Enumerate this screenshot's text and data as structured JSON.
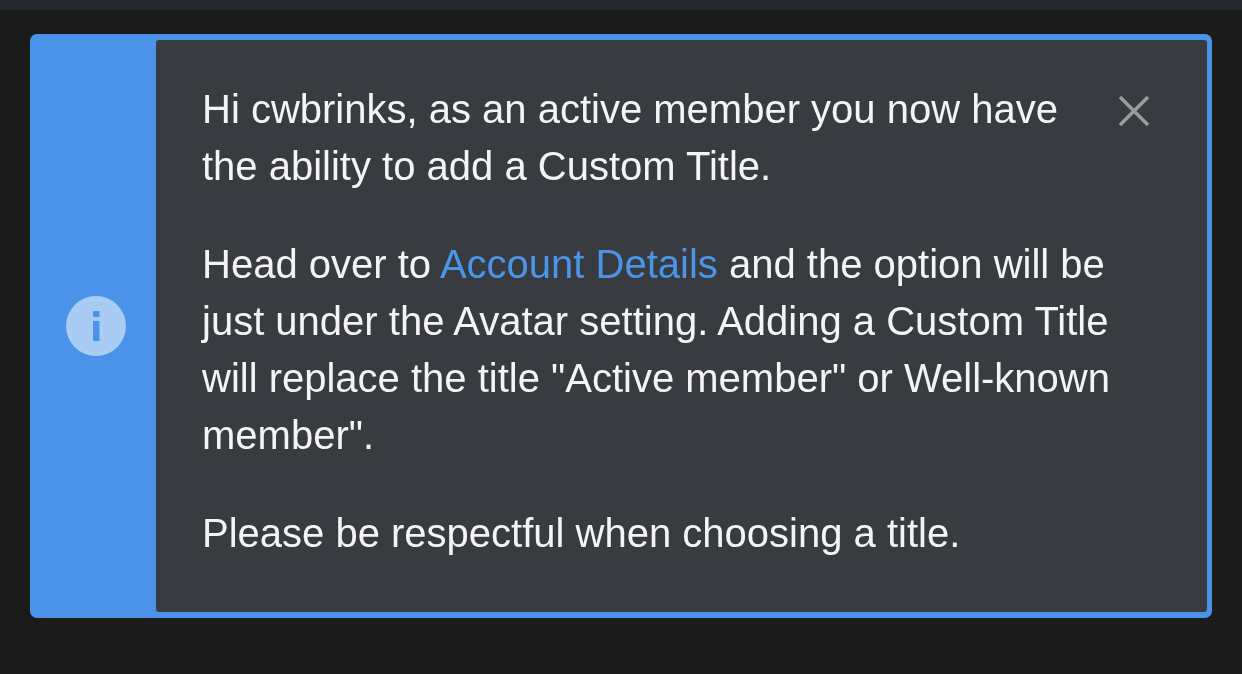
{
  "notice": {
    "kind": "info",
    "paragraphs": [
      [
        {
          "kind": "text",
          "text": "Hi cwbrinks, as an active member you now have the ability to add a Custom Title."
        }
      ],
      [
        {
          "kind": "text",
          "text": "Head over to "
        },
        {
          "kind": "link",
          "text": "Account Details"
        },
        {
          "kind": "text",
          "text": " and the option will be just under the Avatar setting. Adding a Custom Title will replace the title \"Active member\" or Well-known member\"."
        }
      ],
      [
        {
          "kind": "text",
          "text": "Please be respectful when choosing a title."
        }
      ]
    ]
  }
}
